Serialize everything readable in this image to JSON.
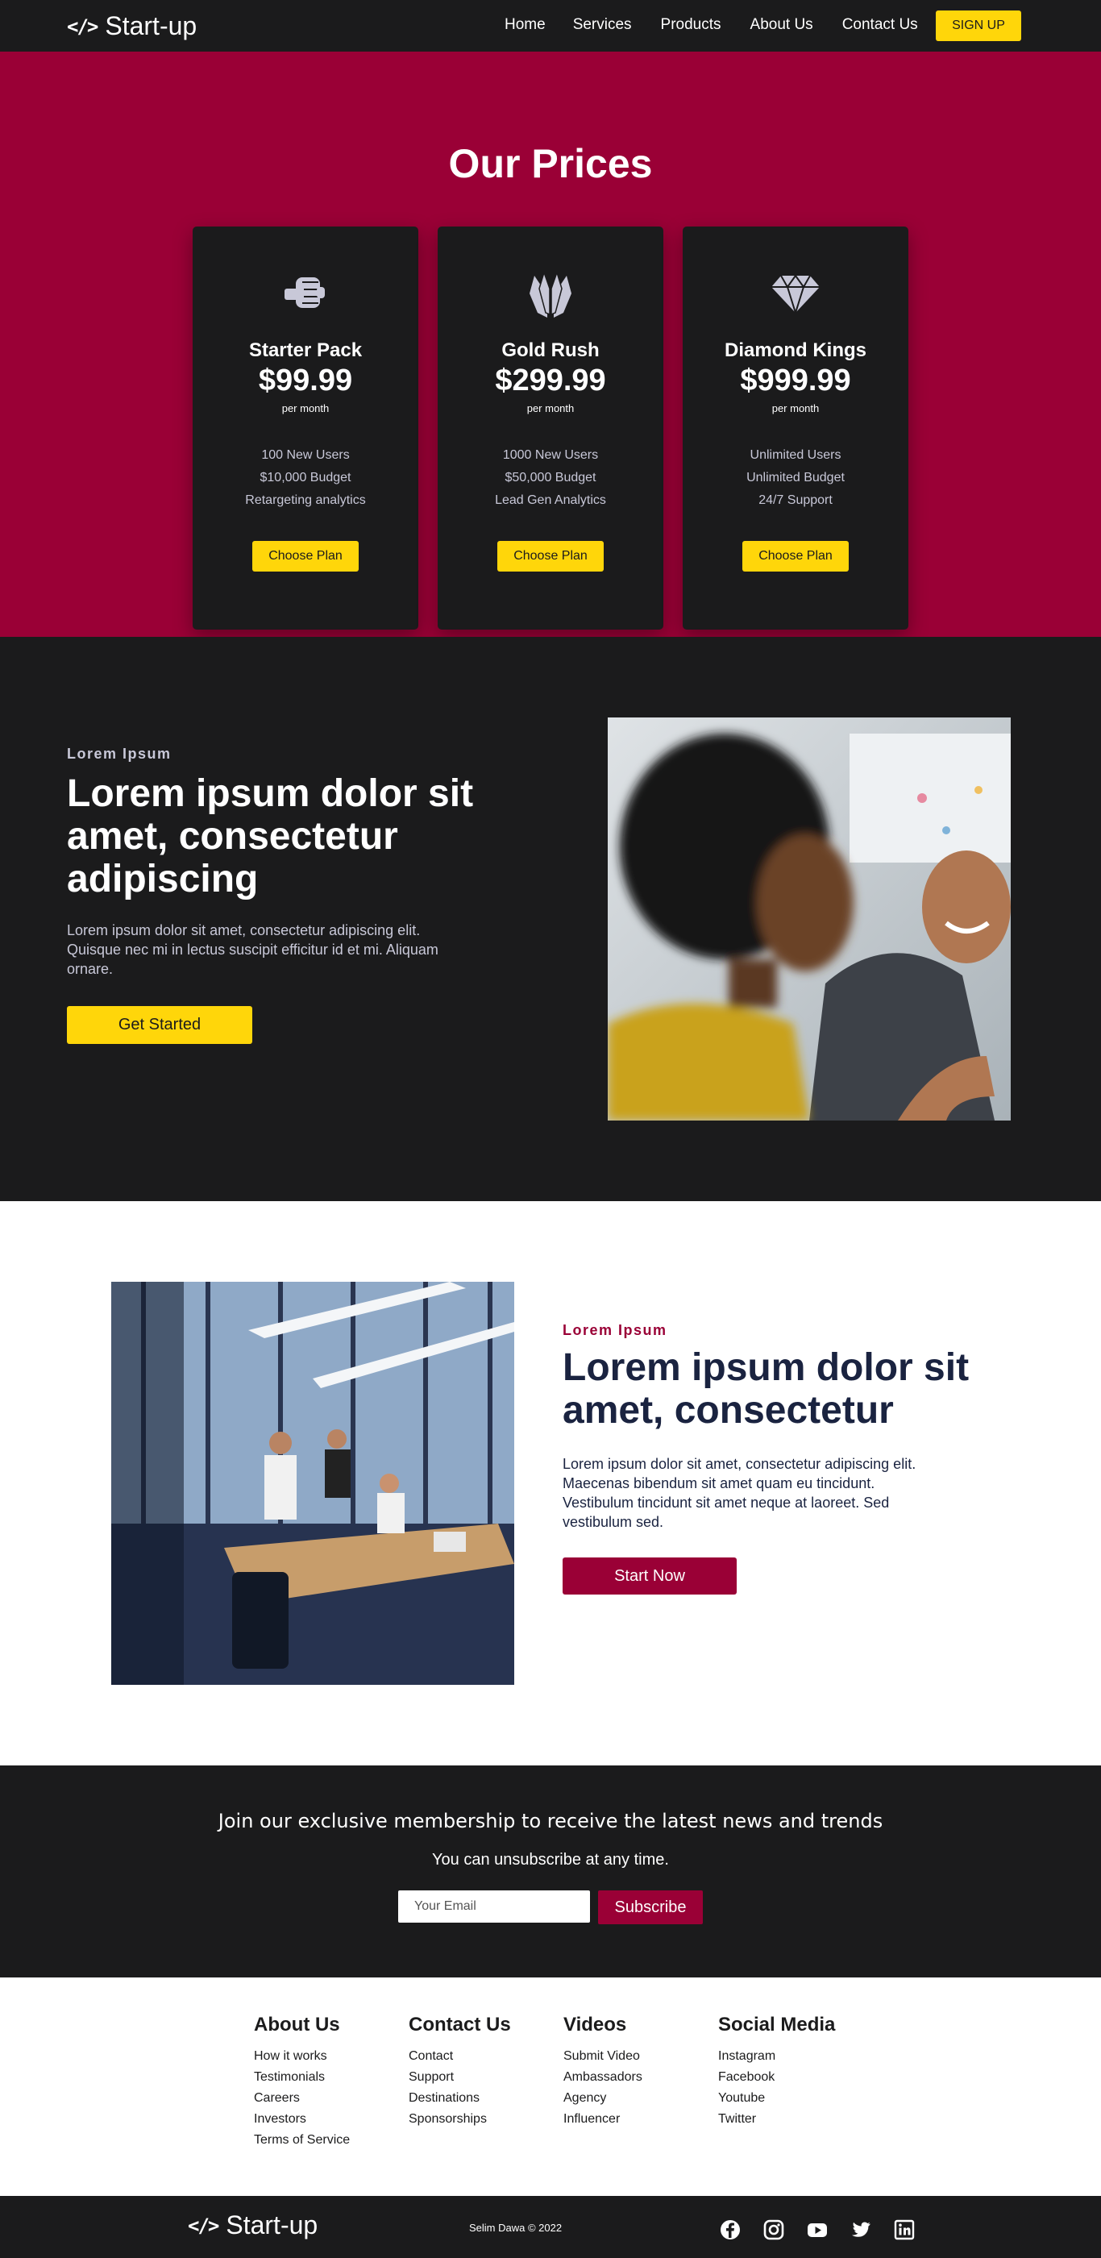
{
  "nav": {
    "brand": "Start-up",
    "links": [
      "Home",
      "Services",
      "Products",
      "About Us",
      "Contact Us"
    ],
    "signup": "SIGN UP"
  },
  "prices": {
    "title": "Our Prices",
    "plans": [
      {
        "icon": "fist-icon",
        "name": "Starter Pack",
        "price": "$99.99",
        "period": "per month",
        "features": [
          "100 New Users",
          "$10,000 Budget",
          "Retargeting analytics"
        ],
        "button": "Choose Plan"
      },
      {
        "icon": "praying-hands-icon",
        "name": "Gold Rush",
        "price": "$299.99",
        "period": "per month",
        "features": [
          "1000 New Users",
          "$50,000 Budget",
          "Lead Gen Analytics"
        ],
        "button": "Choose Plan"
      },
      {
        "icon": "diamond-icon",
        "name": "Diamond Kings",
        "price": "$999.99",
        "period": "per month",
        "features": [
          "Unlimited Users",
          "Unlimited Budget",
          "24/7 Support"
        ],
        "button": "Choose Plan"
      }
    ]
  },
  "hero": {
    "eyebrow": "Lorem Ipsum",
    "headline": "Lorem ipsum dolor sit amet, consectetur adipiscing",
    "paragraph": "Lorem ipsum dolor sit amet, consectetur adipiscing elit. Quisque nec mi in lectus suscipit efficitur id et mi. Aliquam ornare.",
    "button": "Get Started"
  },
  "feature": {
    "eyebrow": "Lorem Ipsum",
    "headline": "Lorem ipsum dolor sit amet, consectetur",
    "paragraph": "Lorem ipsum dolor sit amet, consectetur adipiscing elit. Maecenas bibendum sit amet quam eu tincidunt. Vestibulum tincidunt sit amet neque at laoreet. Sed vestibulum sed.",
    "button": "Start Now"
  },
  "newsletter": {
    "title": "Join our exclusive membership to receive the latest news and trends",
    "subtitle": "You can unsubscribe at any time.",
    "email_placeholder": "Your Email",
    "button": "Subscribe"
  },
  "footer": {
    "columns": [
      {
        "title": "About Us",
        "links": [
          "How it works",
          "Testimonials",
          "Careers",
          "Investors",
          "Terms of Service"
        ]
      },
      {
        "title": "Contact Us",
        "links": [
          "Contact",
          "Support",
          "Destinations",
          "Sponsorships"
        ]
      },
      {
        "title": "Videos",
        "links": [
          "Submit Video",
          "Ambassadors",
          "Agency",
          "Influencer"
        ]
      },
      {
        "title": "Social Media",
        "links": [
          "Instagram",
          "Facebook",
          "Youtube",
          "Twitter"
        ]
      }
    ],
    "brand": "Start-up",
    "copyright": "Selim Dawa © 2022",
    "social_icons": [
      "facebook-icon",
      "instagram-icon",
      "youtube-icon",
      "twitter-icon",
      "linkedin-icon"
    ]
  },
  "colors": {
    "accent_crimson": "#9a0036",
    "accent_yellow": "#ffd60a",
    "dark": "#1b1b1c"
  }
}
